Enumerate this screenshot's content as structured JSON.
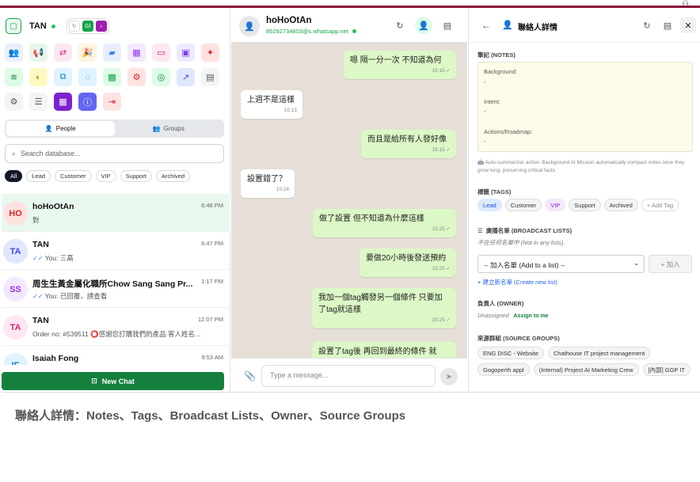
{
  "colors": {
    "brand_green": "#15803d",
    "accent_crimson": "#8a1538",
    "bubble_out": "#dcf8c6",
    "chat_bg": "#e6dfd8",
    "selected_row": "#e9f8ef"
  },
  "sidebar": {
    "brand": "TAN",
    "mini_badges": [
      "refresh-icon",
      "GI",
      "bell-icon"
    ],
    "tools": [
      {
        "icon": "users-icon",
        "glyph": "👥",
        "bg": "#eaf0fb",
        "fg": "#2563eb"
      },
      {
        "icon": "megaphone-icon",
        "glyph": "📢",
        "bg": "#e6f6ec",
        "fg": "#16a34a"
      },
      {
        "icon": "share-icon",
        "glyph": "⇄",
        "bg": "#fce7f3",
        "fg": "#db2777"
      },
      {
        "icon": "party-icon",
        "glyph": "🎉",
        "bg": "#fff4e0",
        "fg": "#ea580c"
      },
      {
        "icon": "truck-icon",
        "glyph": "▰",
        "bg": "#e8eefc",
        "fg": "#3b82f6"
      },
      {
        "icon": "calendar-icon",
        "glyph": "▦",
        "bg": "#f3e8ff",
        "fg": "#9333ea"
      },
      {
        "icon": "ticket-icon",
        "glyph": "▭",
        "bg": "#fde7f1",
        "fg": "#be185d"
      },
      {
        "icon": "bag-icon",
        "glyph": "▣",
        "bg": "#ede9fe",
        "fg": "#7c3aed"
      },
      {
        "icon": "sparkle-icon",
        "glyph": "✦",
        "bg": "#fee2e2",
        "fg": "#dc2626"
      },
      {
        "icon": "layers-icon",
        "glyph": "≋",
        "bg": "#dcfce7",
        "fg": "#15803d"
      },
      {
        "icon": "palette-icon",
        "glyph": "◐",
        "bg": "#fef9c3",
        "fg": "#ca8a04"
      },
      {
        "icon": "copy-icon",
        "glyph": "⧉",
        "bg": "#e0f2fe",
        "fg": "#0284c7"
      },
      {
        "icon": "radar-icon",
        "glyph": "◌",
        "bg": "#e0f2fe",
        "fg": "#0891b2"
      },
      {
        "icon": "chip-icon",
        "glyph": "▩",
        "bg": "#dcfce7",
        "fg": "#16a34a"
      },
      {
        "icon": "robot-icon",
        "glyph": "⚙",
        "bg": "#fee2e2",
        "fg": "#dc2626"
      },
      {
        "icon": "target-icon",
        "glyph": "◎",
        "bg": "#dcfce7",
        "fg": "#15803d"
      },
      {
        "icon": "trend-icon",
        "glyph": "↗",
        "bg": "#e0e7ff",
        "fg": "#4f46e5"
      },
      {
        "icon": "calendar-clock-icon",
        "glyph": "▤",
        "bg": "#f3f4f6",
        "fg": "#555555"
      },
      {
        "icon": "settings-icon",
        "glyph": "⚙",
        "bg": "#f3f4f6",
        "fg": "#555555"
      },
      {
        "icon": "list-icon",
        "glyph": "☰",
        "bg": "#f3f4f6",
        "fg": "#555555"
      },
      {
        "icon": "qr-icon",
        "glyph": "▦",
        "bg": "#7e22ce",
        "fg": "#ffffff"
      },
      {
        "icon": "info-icon",
        "glyph": "ⓘ",
        "bg": "#6366f1",
        "fg": "#ffffff"
      },
      {
        "icon": "logout-icon",
        "glyph": "⇥",
        "bg": "#fee2e2",
        "fg": "#dc2626"
      }
    ],
    "segments": [
      {
        "label": "People",
        "active": true
      },
      {
        "label": "Groups",
        "active": false
      }
    ],
    "search_placeholder": "Search database...",
    "filters": [
      {
        "label": "All",
        "active": true
      },
      {
        "label": "Lead"
      },
      {
        "label": "Customer"
      },
      {
        "label": "VIP"
      },
      {
        "label": "Support"
      },
      {
        "label": "Archived"
      }
    ],
    "chats": [
      {
        "initials": "HO",
        "name": "hoHoOtAn",
        "time": "6:48 PM",
        "preview": "對",
        "ticks": false,
        "selected": true,
        "avatar_bg": "#fee2e2",
        "avatar_fg": "#dc2626"
      },
      {
        "initials": "TA",
        "name": "TAN",
        "time": "6:47 PM",
        "preview": "You: 三高",
        "ticks": true,
        "selected": false,
        "avatar_bg": "#e0e7ff",
        "avatar_fg": "#4f46e5"
      },
      {
        "initials": "SS",
        "name": "周生生黃金屬化職所Chow Sang Sang Pr...",
        "time": "1:17 PM",
        "preview": "You: 已回覆，請查看",
        "ticks": true,
        "selected": false,
        "avatar_bg": "#f3e8ff",
        "avatar_fg": "#9333ea"
      },
      {
        "initials": "TA",
        "name": "TAN",
        "time": "12:07 PM",
        "preview": "Order no: #539511 ⭕感謝您訂購我們的產品 客人姓名...",
        "ticks": false,
        "selected": false,
        "avatar_bg": "#fce7f3",
        "avatar_fg": "#db2777"
      },
      {
        "initials": "IF",
        "name": "Isaiah Fong",
        "time": "9:53 AM",
        "preview": "",
        "ticks": false,
        "selected": false,
        "avatar_bg": "#e0f2fe",
        "avatar_fg": "#0284c7"
      }
    ],
    "new_chat": "New Chat"
  },
  "chat": {
    "title": "hoHoOtAn",
    "subtitle": "85292734603@s.whatsapp.net",
    "messages": [
      {
        "dir": "out",
        "text": "嗯  隔一分一次  不知道為何",
        "time": "15:15"
      },
      {
        "dir": "in",
        "text": "上週不是這樣",
        "time": "15:15"
      },
      {
        "dir": "out",
        "text": "而且是給所有人發好像",
        "time": "15:15"
      },
      {
        "dir": "in",
        "text": "設置錯了？",
        "time": "15:24"
      },
      {
        "dir": "out",
        "text": "做了設置  但不知道為什麼這樣",
        "time": "15:25"
      },
      {
        "dir": "out",
        "text": "要做20小時後發送預約",
        "time": "15:25"
      },
      {
        "dir": "out",
        "text": "我加一個tag觸發另一個條件   只要加了tag就這樣",
        "time": "15:25"
      },
      {
        "dir": "out",
        "text": "設置了tag後  再回到最終的條件  就",
        "time": ""
      }
    ],
    "composer_placeholder": "Type a message..."
  },
  "panel": {
    "title": "聯絡人詳情",
    "notes_label": "筆記 (NOTES)",
    "notes_lines": [
      "Background:",
      "-",
      "",
      "Intent:",
      "-",
      "",
      "Actions/Roadmap:",
      "-"
    ],
    "notes_hint": "🤖 Auto-summarizer active: Background AI Mission automatically compact notes once they grow long, preserving critical facts.",
    "tags_label": "標籤 (TAGS)",
    "tags": [
      {
        "label": "Lead",
        "bg": "#dbeafe",
        "fg": "#1d4ed8"
      },
      {
        "label": "Customer",
        "bg": "#f3f4f6",
        "fg": "#333333"
      },
      {
        "label": "VIP",
        "bg": "#f3e8ff",
        "fg": "#7e22ce"
      },
      {
        "label": "Support",
        "bg": "#f3f4f6",
        "fg": "#333333"
      },
      {
        "label": "Archived",
        "bg": "#f3f4f6",
        "fg": "#333333"
      }
    ],
    "add_tag": "+ Add Tag",
    "broadcast_label": "廣播名單 (BROADCAST LISTS)",
    "broadcast_empty": "不在任何名單中 (Not in any lists).",
    "broadcast_select": "-- 加入名單 (Add to a list) --",
    "broadcast_add": "+  加入",
    "new_list": "+  建立新名單 (Create new list)",
    "owner_label": "負責人 (OWNER)",
    "owner_value": "Unassigned",
    "assign": "Assign to me",
    "groups_label": "來源群組 (SOURCE GROUPS)",
    "groups": [
      "ENG DISC - Website",
      "Chathouse IT project management",
      "Gogoperth appl",
      "(Internal) Project AI Marketing Crew",
      "[內部] GGP IT"
    ]
  },
  "caption": "聯絡人詳情：Notes、Tags、Broadcast Lists、Owner、Source Groups"
}
